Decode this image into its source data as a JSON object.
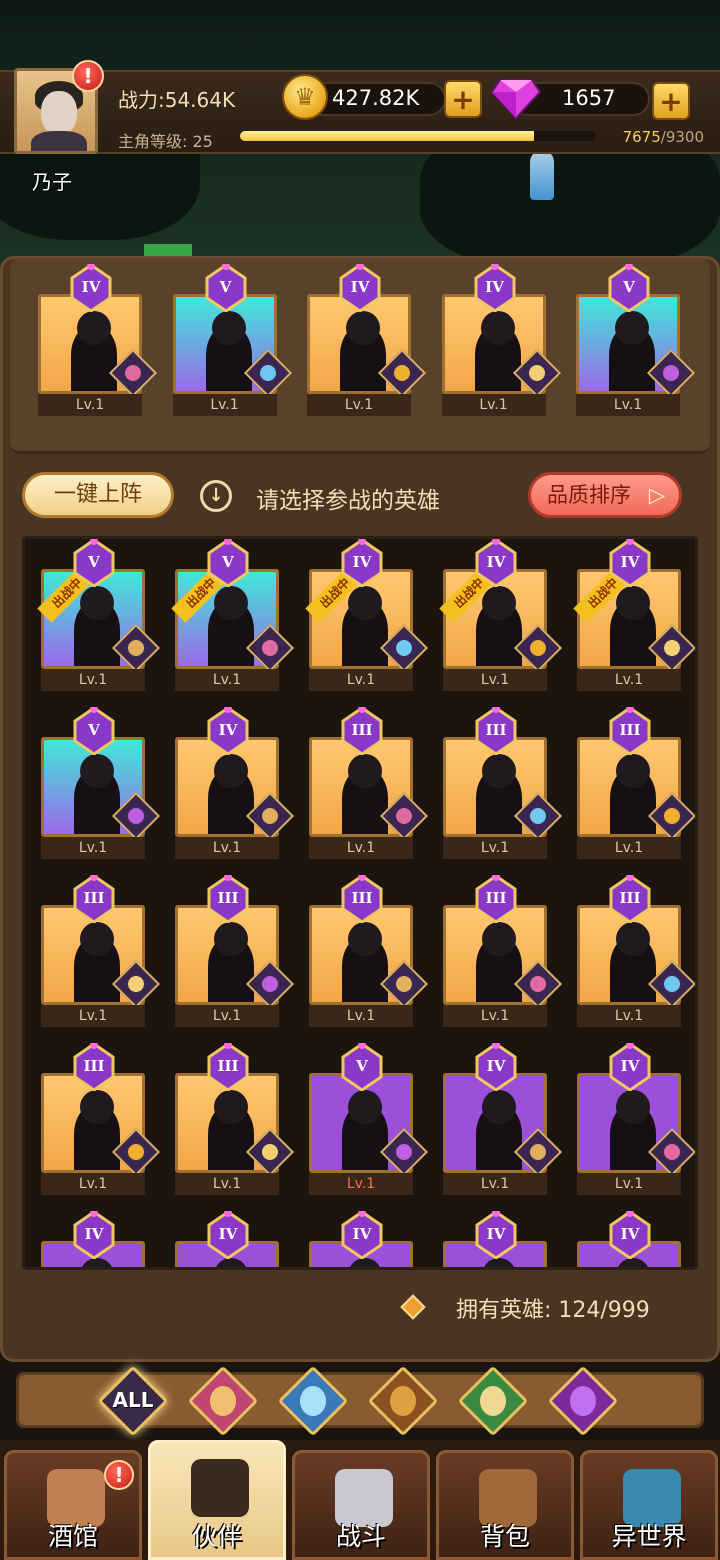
{
  "player": {
    "name": "乃子",
    "power_label": "战力:54.64K",
    "level_label": "主角等级: 25",
    "xp_current": "7675",
    "xp_max": "/9300",
    "xp_fraction": 0.825
  },
  "resources": {
    "gold": "427.82K",
    "gems": "1657",
    "plus": "+"
  },
  "alerts": {
    "mark": "!"
  },
  "lineup": [
    {
      "rank": "IV",
      "level": "Lv.1",
      "bg": "gold"
    },
    {
      "rank": "V",
      "level": "Lv.1",
      "bg": "cyan"
    },
    {
      "rank": "IV",
      "level": "Lv.1",
      "bg": "gold"
    },
    {
      "rank": "IV",
      "level": "Lv.1",
      "bg": "gold"
    },
    {
      "rank": "V",
      "level": "Lv.1",
      "bg": "cyan"
    }
  ],
  "actions": {
    "auto_deploy": "一键上阵",
    "hint": "请选择参战的英雄",
    "sort": "品质排序",
    "sort_arrow": "▷"
  },
  "deployed_tag": "出战中",
  "roster": [
    {
      "rank": "V",
      "level": "Lv.1",
      "bg": "cyan",
      "deployed": true
    },
    {
      "rank": "V",
      "level": "Lv.1",
      "bg": "cyan",
      "deployed": true
    },
    {
      "rank": "IV",
      "level": "Lv.1",
      "bg": "gold",
      "deployed": true
    },
    {
      "rank": "IV",
      "level": "Lv.1",
      "bg": "gold",
      "deployed": true
    },
    {
      "rank": "IV",
      "level": "Lv.1",
      "bg": "gold",
      "deployed": true
    },
    {
      "rank": "V",
      "level": "Lv.1",
      "bg": "cyan"
    },
    {
      "rank": "IV",
      "level": "Lv.1",
      "bg": "gold"
    },
    {
      "rank": "III",
      "level": "Lv.1",
      "bg": "gold"
    },
    {
      "rank": "III",
      "level": "Lv.1",
      "bg": "gold"
    },
    {
      "rank": "III",
      "level": "Lv.1",
      "bg": "gold"
    },
    {
      "rank": "III",
      "level": "Lv.1",
      "bg": "gold"
    },
    {
      "rank": "III",
      "level": "Lv.1",
      "bg": "gold"
    },
    {
      "rank": "III",
      "level": "Lv.1",
      "bg": "gold"
    },
    {
      "rank": "III",
      "level": "Lv.1",
      "bg": "gold"
    },
    {
      "rank": "III",
      "level": "Lv.1",
      "bg": "gold"
    },
    {
      "rank": "III",
      "level": "Lv.1",
      "bg": "gold"
    },
    {
      "rank": "III",
      "level": "Lv.1",
      "bg": "gold"
    },
    {
      "rank": "V",
      "level": "Lv.1",
      "bg": "purple",
      "red": true
    },
    {
      "rank": "IV",
      "level": "Lv.1",
      "bg": "purple"
    },
    {
      "rank": "IV",
      "level": "Lv.1",
      "bg": "purple"
    },
    {
      "rank": "IV",
      "level": "",
      "bg": "purple"
    },
    {
      "rank": "IV",
      "level": "",
      "bg": "purple"
    },
    {
      "rank": "IV",
      "level": "",
      "bg": "purple"
    },
    {
      "rank": "IV",
      "level": "",
      "bg": "purple"
    },
    {
      "rank": "IV",
      "level": "",
      "bg": "purple"
    }
  ],
  "owned_label": "拥有英雄: 124/999",
  "filters": [
    {
      "label": "ALL",
      "icon": "all-filter"
    },
    {
      "label": "",
      "icon": "human-knight-icon"
    },
    {
      "label": "",
      "icon": "fish-creature-icon"
    },
    {
      "label": "",
      "icon": "lion-icon"
    },
    {
      "label": "",
      "icon": "elf-icon"
    },
    {
      "label": "",
      "icon": "demon-icon"
    }
  ],
  "nav": [
    {
      "label": "酒馆",
      "icon": "beer-mug-icon"
    },
    {
      "label": "伙伴",
      "icon": "partner-avatar-icon"
    },
    {
      "label": "战斗",
      "icon": "crossed-swords-icon"
    },
    {
      "label": "背包",
      "icon": "backpack-icon"
    },
    {
      "label": "异世界",
      "icon": "portal-icon"
    }
  ],
  "colors": {
    "gold_bg": "#f2a648",
    "cyan_bg": "#40e8d8",
    "purple_bg": "#9a50d8",
    "panel": "#4a3523",
    "accent_red": "#f06a5a"
  }
}
